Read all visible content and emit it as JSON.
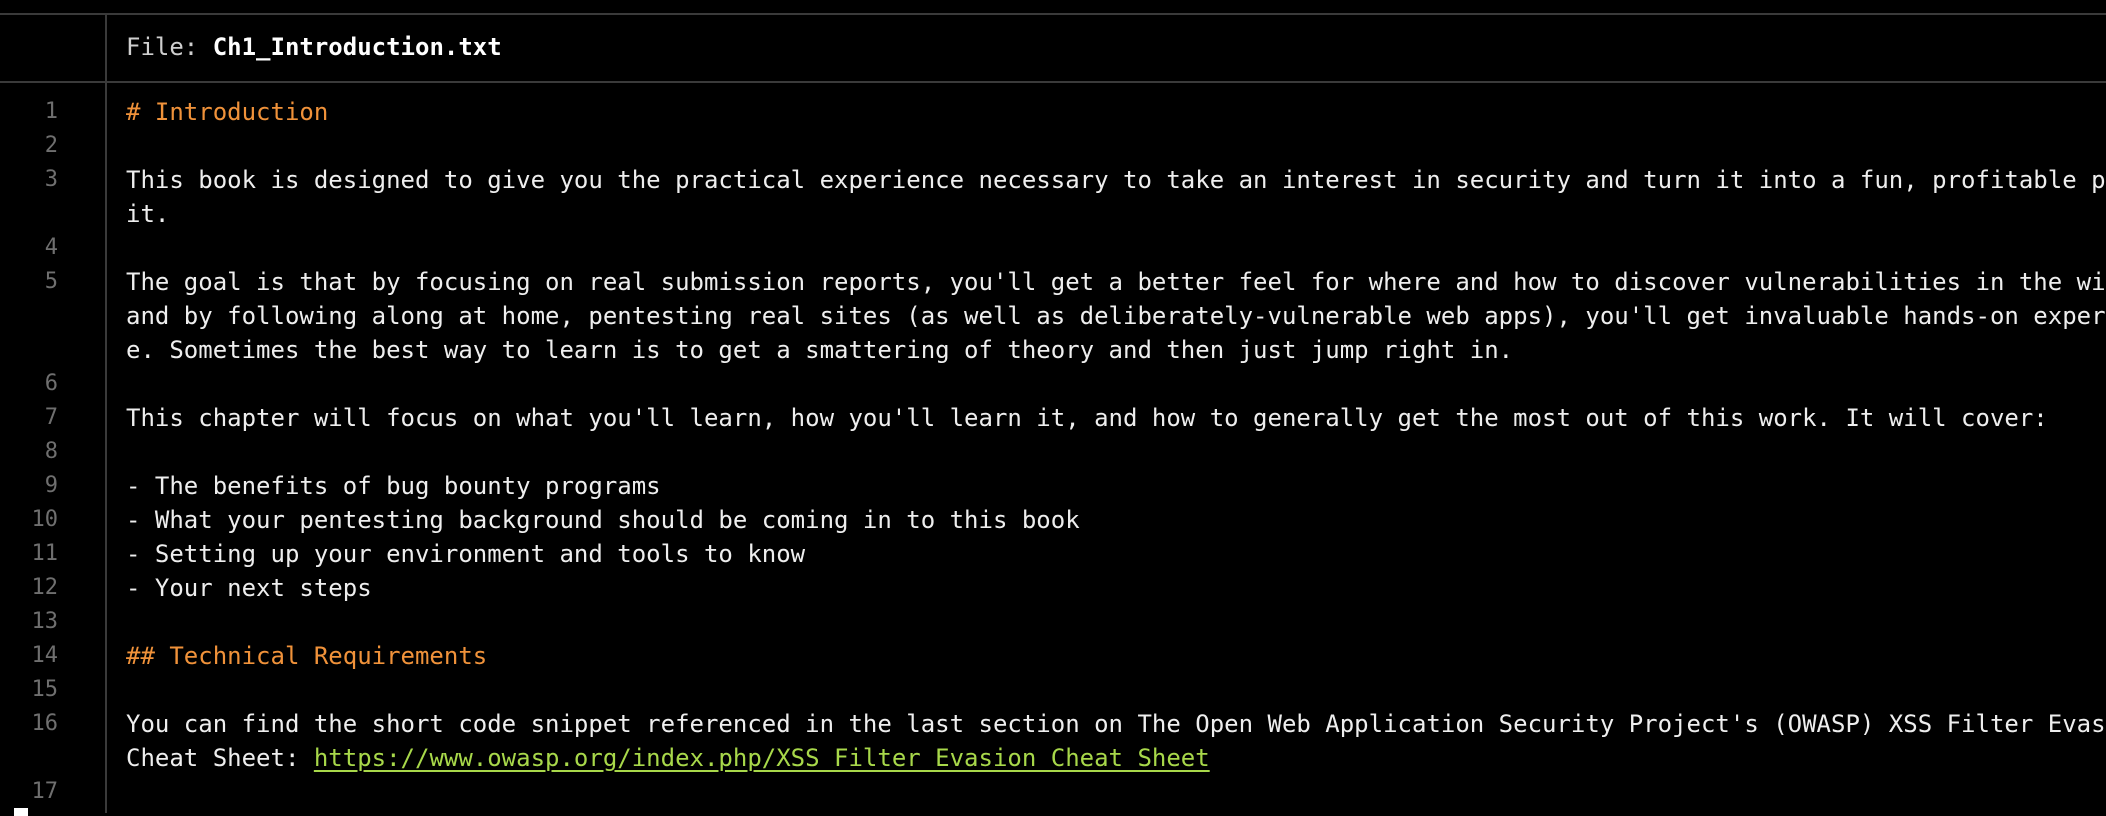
{
  "header": {
    "prefix": "File: ",
    "filename": "Ch1_Introduction.txt"
  },
  "colors": {
    "background": "#000000",
    "text": "#eeeeee",
    "heading": "#f0923a",
    "link": "#a8d84a",
    "line_number": "#6f6f6f",
    "divider": "#3a3a3a"
  },
  "lines": [
    {
      "number": "1",
      "rows": [
        "# Introduction"
      ],
      "kind": "heading"
    },
    {
      "number": "2",
      "rows": [
        ""
      ]
    },
    {
      "number": "3",
      "rows": [
        "This book is designed to give you the practical experience necessary to take an interest in security and turn it into a fun, profitable pursu",
        "it."
      ]
    },
    {
      "number": "4",
      "rows": [
        ""
      ]
    },
    {
      "number": "5",
      "rows": [
        "The goal is that by focusing on real submission reports, you'll get a better feel for where and how to discover vulnerabilities in the wild,",
        "and by following along at home, pentesting real sites (as well as deliberately-vulnerable web apps), you'll get invaluable hands-on experienc",
        "e. Sometimes the best way to learn is to get a smattering of theory and then just jump right in."
      ]
    },
    {
      "number": "6",
      "rows": [
        ""
      ]
    },
    {
      "number": "7",
      "rows": [
        "This chapter will focus on what you'll learn, how you'll learn it, and how to generally get the most out of this work. It will cover:"
      ]
    },
    {
      "number": "8",
      "rows": [
        ""
      ]
    },
    {
      "number": "9",
      "rows": [
        "- The benefits of bug bounty programs"
      ]
    },
    {
      "number": "10",
      "rows": [
        "- What your pentesting background should be coming in to this book"
      ]
    },
    {
      "number": "11",
      "rows": [
        "- Setting up your environment and tools to know"
      ]
    },
    {
      "number": "12",
      "rows": [
        "- Your next steps"
      ]
    },
    {
      "number": "13",
      "rows": [
        ""
      ]
    },
    {
      "number": "14",
      "rows": [
        "## Technical Requirements"
      ],
      "kind": "heading"
    },
    {
      "number": "15",
      "rows": [
        ""
      ]
    },
    {
      "number": "16",
      "rows": [
        "You can find the short code snippet referenced in the last section on The Open Web Application Security Project's (OWASP) XSS Filter Evasion"
      ],
      "link_row": {
        "prefix": "Cheat Sheet: ",
        "url": "https://www.owasp.org/index.php/XSS_Filter_Evasion_Cheat_Sheet"
      }
    },
    {
      "number": "17",
      "rows": [
        ""
      ]
    }
  ]
}
